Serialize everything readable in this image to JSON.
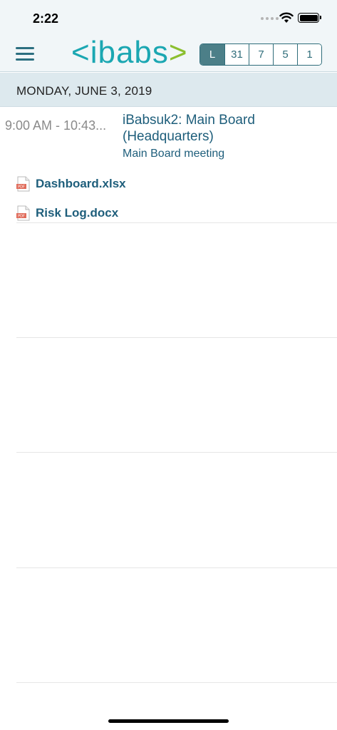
{
  "status": {
    "time": "2:22",
    "icons": [
      "cellular-signal-icon",
      "wifi-icon",
      "battery-icon"
    ]
  },
  "header": {
    "menu_icon": "hamburger-menu-icon",
    "logo": {
      "left": "<",
      "text": "ibabs",
      "right": ">"
    },
    "view_segments": [
      {
        "label": "L"
      },
      {
        "label": "31"
      },
      {
        "label": "7"
      },
      {
        "label": "5"
      },
      {
        "label": "1"
      }
    ]
  },
  "date_header": "MONDAY, JUNE 3, 2019",
  "event": {
    "time": "9:00 AM - 10:43...",
    "title": "iBabsuk2: Main Board (Headquarters)",
    "subtitle": "Main Board meeting"
  },
  "documents": [
    {
      "name": "Dashboard.xlsx",
      "icon": "pdf-file-icon"
    },
    {
      "name": "Risk Log.docx",
      "icon": "pdf-file-icon"
    }
  ],
  "colors": {
    "brand_teal": "#1ba7b2",
    "brand_green": "#8bbf2f",
    "link_blue": "#1e5e7b",
    "selected_segment": "#4c7f88"
  }
}
